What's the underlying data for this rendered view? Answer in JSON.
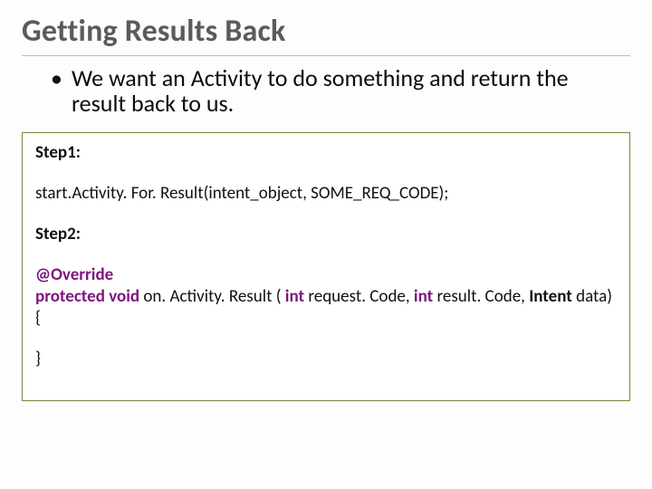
{
  "title": "Getting Results Back",
  "bullet": {
    "dot": "•",
    "text": "We want an Activity to do something and return the result back to us."
  },
  "box": {
    "step1_label": "Step1:",
    "code_line": "start.Activity. For. Result(intent_object,  SOME_REQ_CODE);",
    "step2_label": "Step2:",
    "override": "@Override",
    "sig": {
      "kw_protected": "protected",
      "kw_void": "void",
      "method": " on. Activity. Result (",
      "kw_int1": "int",
      "arg1": " request. Code, ",
      "kw_int2": "int",
      "arg2": " result. Code, ",
      "kw_intent": "Intent",
      "arg3": " data)"
    },
    "brace_open": "{",
    "brace_close": "}"
  }
}
